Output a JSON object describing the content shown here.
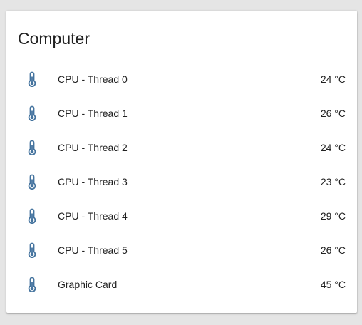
{
  "card": {
    "title": "Computer"
  },
  "colors": {
    "icon": "#44739e",
    "text": "#212121",
    "card_bg": "#ffffff",
    "page_bg": "#e5e5e5"
  },
  "entities": [
    {
      "name": "CPU - Thread 0",
      "state": "24 °C",
      "icon": "thermometer-icon"
    },
    {
      "name": "CPU - Thread 1",
      "state": "26 °C",
      "icon": "thermometer-icon"
    },
    {
      "name": "CPU - Thread 2",
      "state": "24 °C",
      "icon": "thermometer-icon"
    },
    {
      "name": "CPU - Thread 3",
      "state": "23 °C",
      "icon": "thermometer-icon"
    },
    {
      "name": "CPU - Thread 4",
      "state": "29 °C",
      "icon": "thermometer-icon"
    },
    {
      "name": "CPU - Thread 5",
      "state": "26 °C",
      "icon": "thermometer-icon"
    },
    {
      "name": "Graphic Card",
      "state": "45 °C",
      "icon": "thermometer-icon"
    }
  ]
}
